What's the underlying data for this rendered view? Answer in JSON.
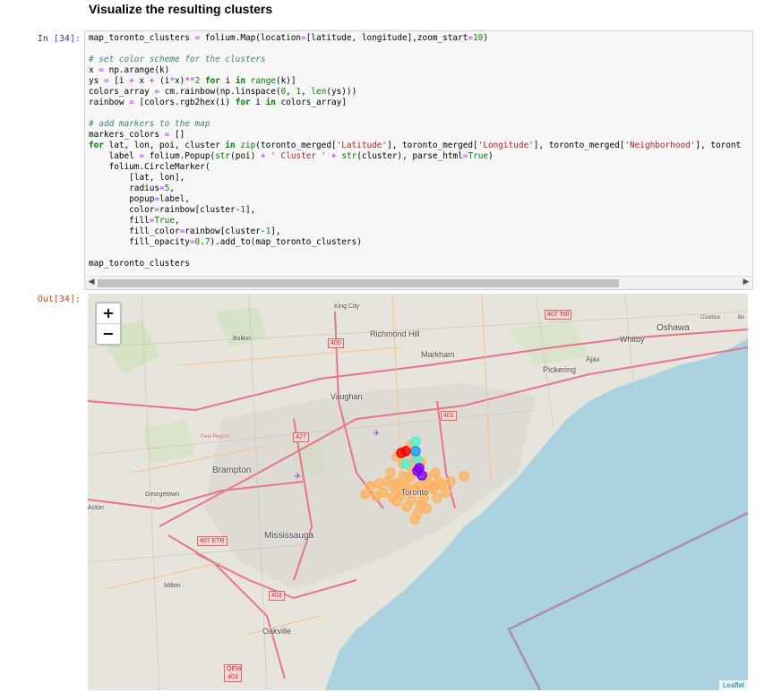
{
  "heading": "Visualize the resulting clusters",
  "input_prompt": "In [34]:",
  "output_prompt": "Out[34]:",
  "code_lines": [
    "map_toronto_clusters = folium.Map(location=[latitude, longitude],zoom_start=10)",
    "",
    "# set color scheme for the clusters",
    "x = np.arange(k)",
    "ys = [i + x + (i*x)**2 for i in range(k)]",
    "colors_array = cm.rainbow(np.linspace(0, 1, len(ys)))",
    "rainbow = [colors.rgb2hex(i) for i in colors_array]",
    "",
    "# add markers to the map",
    "markers_colors = []",
    "for lat, lon, poi, cluster in zip(toronto_merged['Latitude'], toronto_merged['Longitude'], toronto_merged['Neighborhood'], toront",
    "    label = folium.Popup(str(poi) + ' Cluster ' + str(cluster), parse_html=True)",
    "    folium.CircleMarker(",
    "        [lat, lon],",
    "        radius=5,",
    "        popup=label,",
    "        color=rainbow[cluster-1],",
    "        fill=True,",
    "        fill_color=rainbow[cluster-1],",
    "        fill_opacity=0.7).add_to(map_toronto_clusters)",
    "",
    "map_toronto_clusters"
  ],
  "scrollbar": {
    "left_arrow": "◀",
    "right_arrow": "▶"
  },
  "map": {
    "zoom_in": "+",
    "zoom_out": "−",
    "attribution": "Leaflet",
    "places": {
      "king_city": "King City",
      "richmond_hill": "Richmond Hill",
      "markham": "Markham",
      "bolton": "Bolton",
      "whitby": "Whitby",
      "oshawa": "Oshawa",
      "courtice": "Courtice",
      "bo": "Bo",
      "ajax": "Ajax",
      "pickering": "Pickering",
      "vaughan": "Vaughan",
      "peel_region": "Peel Region",
      "brampton": "Brampton",
      "georgetown": "Georgetown",
      "acton": "Acton",
      "mississauga": "Mississauga",
      "milton": "Milton",
      "oakville": "Oakville",
      "toronto": "Toronto"
    },
    "highway_shields": {
      "h407_toll": "407 Toll",
      "h400": "400",
      "h401": "401",
      "h427": "427",
      "h407_etr": "407 ETR",
      "h403": "403",
      "qew_403": "QEW 403"
    },
    "marker_colors": {
      "orange": "#ffb360",
      "red": "#ff0000",
      "cyan": "#4df3ce",
      "blue": "#1996f3",
      "purple": "#8000ff"
    }
  }
}
